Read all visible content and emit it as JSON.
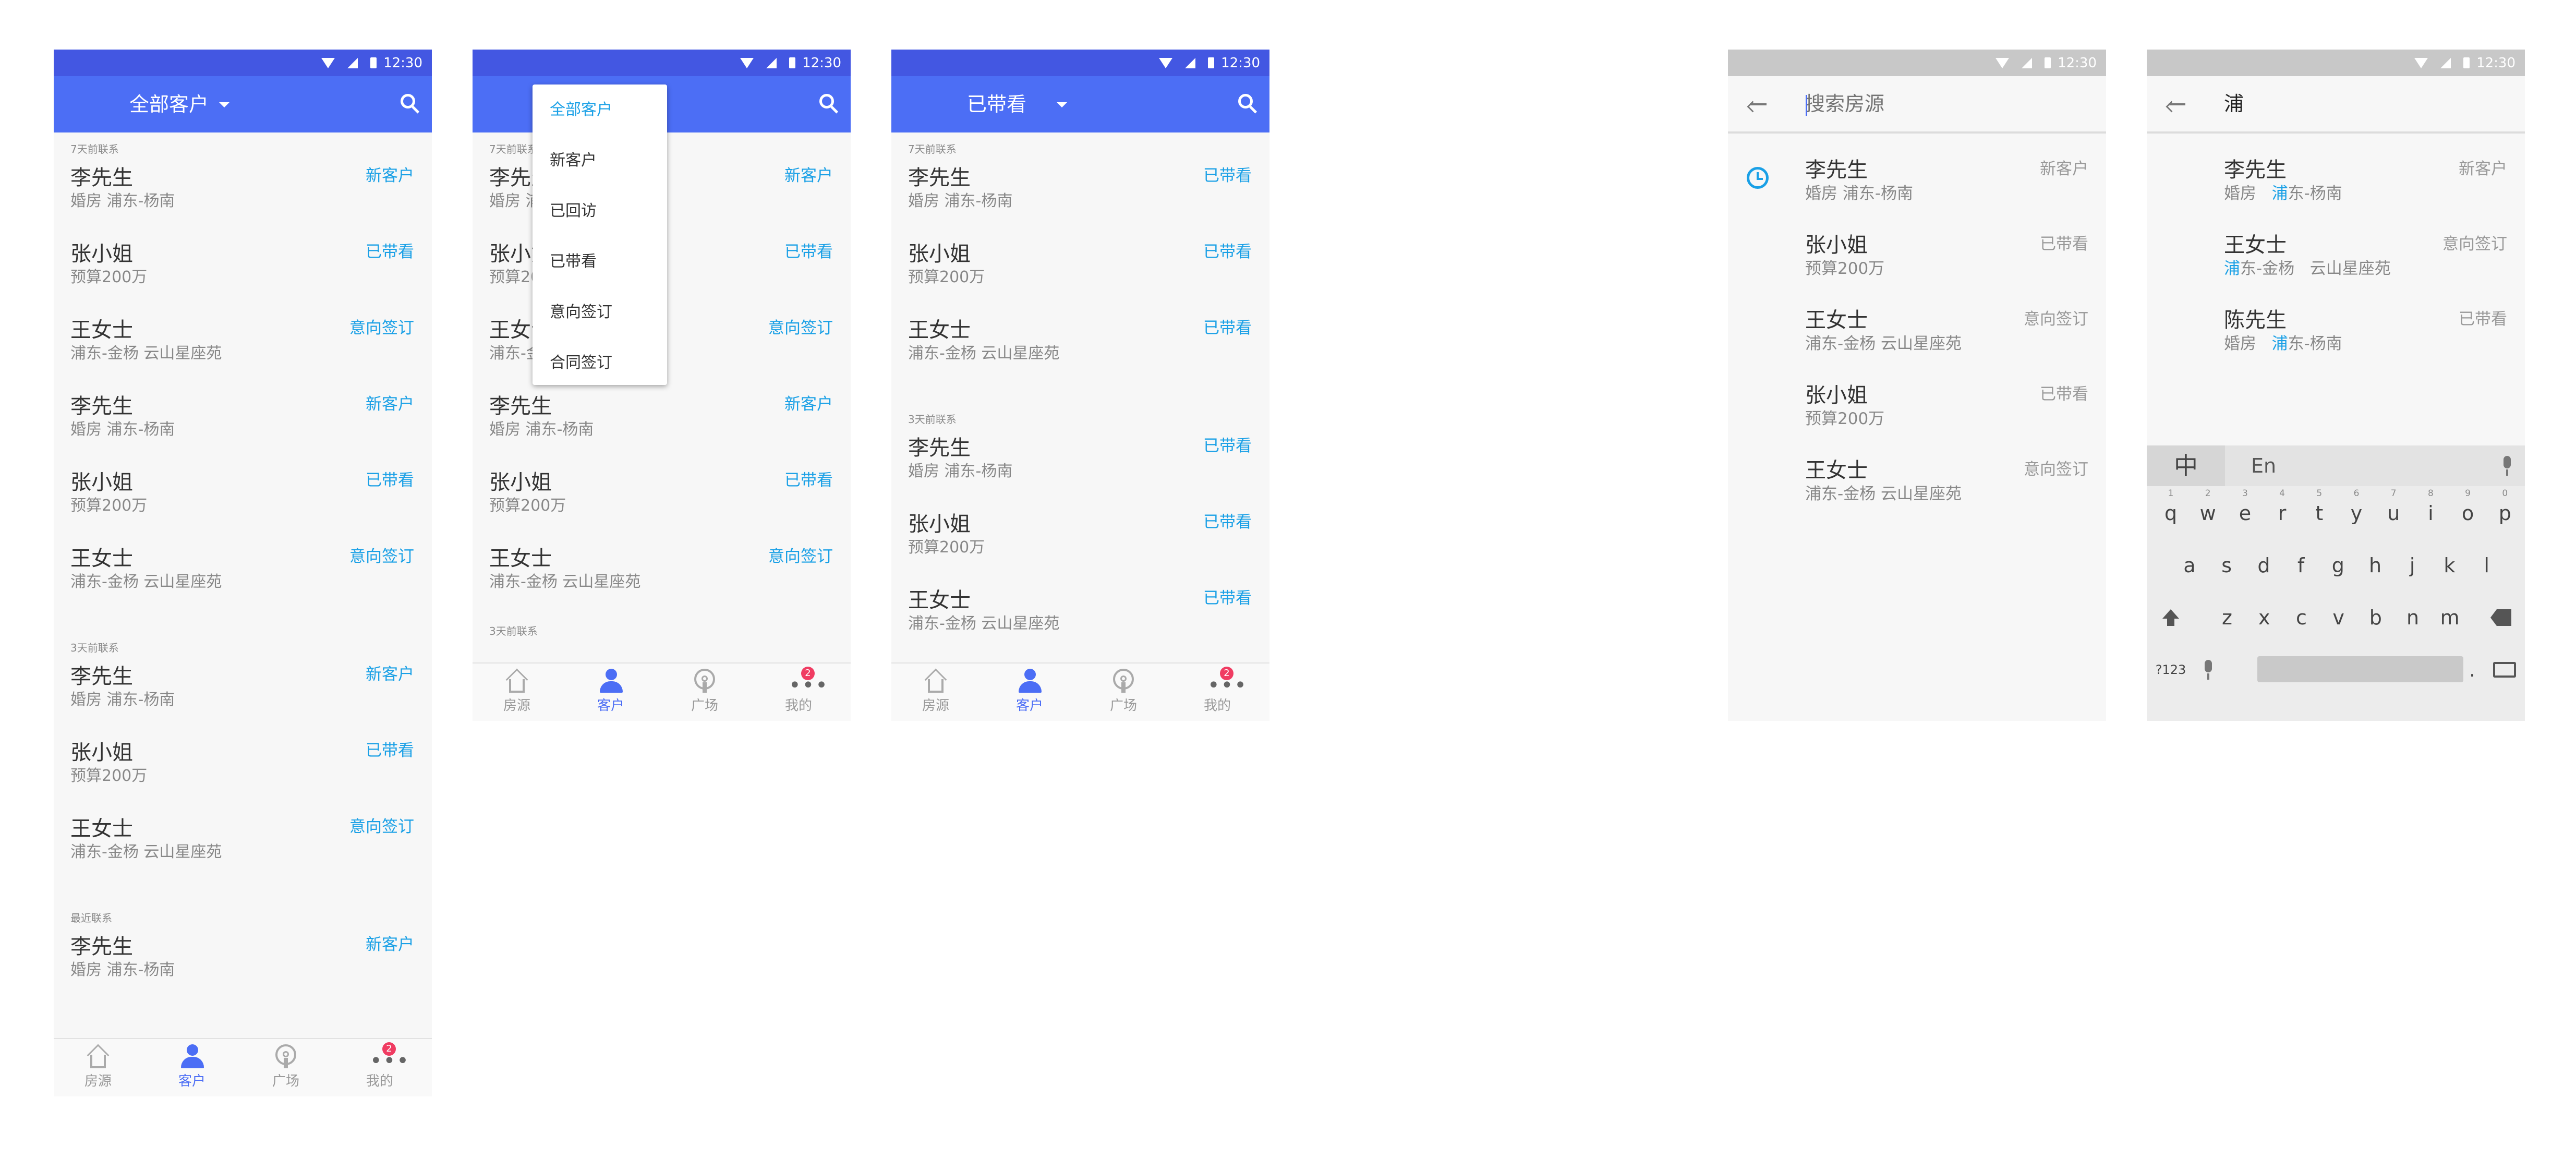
{
  "status_bar": {
    "time": "12:30"
  },
  "tab_bar": [
    {
      "label": "房源",
      "icon": "home-icon"
    },
    {
      "label": "客户",
      "icon": "user-icon"
    },
    {
      "label": "广场",
      "icon": "plaza-icon"
    },
    {
      "label": "我的",
      "icon": "more-icon",
      "badge": "2"
    }
  ],
  "screen1": {
    "title": "全部客户",
    "sections": [
      {
        "label": "7天前联系",
        "items": [
          {
            "name": "李先生",
            "sub": "婚房   浦东-杨南",
            "status": "新客户"
          },
          {
            "name": "张小姐",
            "sub": "预算200万",
            "status": "已带看"
          },
          {
            "name": "王女士",
            "sub": "浦东-金杨   云山星座苑",
            "status": "意向签订"
          },
          {
            "name": "李先生",
            "sub": "婚房   浦东-杨南",
            "status": "新客户"
          },
          {
            "name": "张小姐",
            "sub": "预算200万",
            "status": "已带看"
          },
          {
            "name": "王女士",
            "sub": "浦东-金杨   云山星座苑",
            "status": "意向签订"
          }
        ]
      },
      {
        "label": "3天前联系",
        "items": [
          {
            "name": "李先生",
            "sub": "婚房   浦东-杨南",
            "status": "新客户"
          },
          {
            "name": "张小姐",
            "sub": "预算200万",
            "status": "已带看"
          },
          {
            "name": "王女士",
            "sub": "浦东-金杨   云山星座苑",
            "status": "意向签订"
          }
        ]
      },
      {
        "label": "最近联系",
        "items": [
          {
            "name": "李先生",
            "sub": "婚房   浦东-杨南",
            "status": "新客户"
          }
        ]
      }
    ]
  },
  "screen2": {
    "dropdown": [
      "全部客户",
      "新客户",
      "已回访",
      "已带看",
      "意向签订",
      "合同签订"
    ],
    "section_label": "7天前联系",
    "section_label_2": "3天前联系",
    "items": [
      {
        "name": "李先生",
        "sub": "婚房   浦东-杨南",
        "status": "新客户"
      },
      {
        "name": "张小姐",
        "sub": "预算200万",
        "status": "已带看"
      },
      {
        "name": "王女士",
        "sub": "浦东-金杨   云山星座苑",
        "status": "意向签订"
      },
      {
        "name": "李先生",
        "sub": "婚房   浦东-杨南",
        "status": "新客户"
      },
      {
        "name": "张小姐",
        "sub": "预算200万",
        "status": "已带看"
      },
      {
        "name": "王女士",
        "sub": "浦东-金杨   云山星座苑",
        "status": "意向签订"
      }
    ]
  },
  "screen3": {
    "title": "已带看",
    "sections": [
      {
        "label": "7天前联系",
        "items": [
          {
            "name": "李先生",
            "sub": "婚房   浦东-杨南",
            "status": "已带看"
          },
          {
            "name": "张小姐",
            "sub": "预算200万",
            "status": "已带看"
          },
          {
            "name": "王女士",
            "sub": "浦东-金杨   云山星座苑",
            "status": "已带看"
          }
        ]
      },
      {
        "label": "3天前联系",
        "items": [
          {
            "name": "李先生",
            "sub": "婚房   浦东-杨南",
            "status": "已带看"
          },
          {
            "name": "张小姐",
            "sub": "预算200万",
            "status": "已带看"
          },
          {
            "name": "王女士",
            "sub": "浦东-金杨   云山星座苑",
            "status": "已带看"
          }
        ]
      }
    ]
  },
  "screen4": {
    "search_placeholder": "搜索房源",
    "history": [
      {
        "name": "李先生",
        "sub": "婚房   浦东-杨南",
        "status": "新客户"
      },
      {
        "name": "张小姐",
        "sub": "预算200万",
        "status": "已带看"
      },
      {
        "name": "王女士",
        "sub": "浦东-金杨   云山星座苑",
        "status": "意向签订"
      },
      {
        "name": "张小姐",
        "sub": "预算200万",
        "status": "已带看"
      },
      {
        "name": "王女士",
        "sub": "浦东-金杨   云山星座苑",
        "status": "意向签订"
      }
    ]
  },
  "screen5": {
    "search_value": "浦",
    "results": [
      {
        "name": "李先生",
        "sub_pre": "婚房   ",
        "sub_hl": "浦",
        "sub_post": "东-杨南",
        "status": "新客户"
      },
      {
        "name": "王女士",
        "sub_pre": "",
        "sub_hl": "浦",
        "sub_post": "东-金杨   云山星座苑",
        "status": "意向签订"
      },
      {
        "name": "陈先生",
        "sub_pre": "婚房   ",
        "sub_hl": "浦",
        "sub_post": "东-杨南",
        "status": "已带看"
      }
    ],
    "keyboard": {
      "lang_zh": "中",
      "lang_en": "En",
      "row1": [
        "q",
        "w",
        "e",
        "r",
        "t",
        "y",
        "u",
        "i",
        "o",
        "p"
      ],
      "row1_hints": [
        "1",
        "2",
        "3",
        "4",
        "5",
        "6",
        "7",
        "8",
        "9",
        "0"
      ],
      "row2": [
        "a",
        "s",
        "d",
        "f",
        "g",
        "h",
        "j",
        "k",
        "l"
      ],
      "row3": [
        "z",
        "x",
        "c",
        "v",
        "b",
        "n",
        "m"
      ],
      "symbols_key": "?123",
      "period_key": "."
    }
  }
}
